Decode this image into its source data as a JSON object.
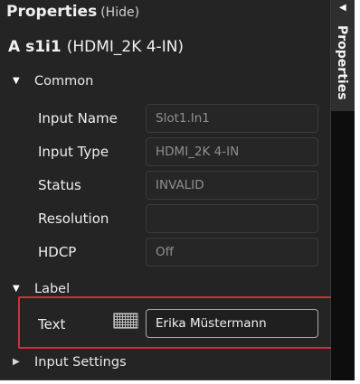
{
  "panel": {
    "title": "Properties",
    "hide_label": "(Hide)"
  },
  "object": {
    "name": "A s1i1",
    "type": "(HDMI_2K 4-IN)"
  },
  "sections": {
    "common": {
      "label": "Common",
      "expanded": true,
      "rows": [
        {
          "label": "Input Name",
          "value": "Slot1.In1"
        },
        {
          "label": "Input Type",
          "value": "HDMI_2K 4-IN"
        },
        {
          "label": "Status",
          "value": "INVALID"
        },
        {
          "label": "Resolution",
          "value": ""
        },
        {
          "label": "HDCP",
          "value": "Off"
        }
      ]
    },
    "label": {
      "label": "Label",
      "expanded": true,
      "text_label": "Text",
      "text_value": "Erika Müstermann"
    },
    "input_settings": {
      "label": "Input Settings",
      "expanded": false
    }
  },
  "side_tab": {
    "label": "Properties"
  },
  "colors": {
    "panel_bg": "#242424",
    "highlight": "#c8323c"
  },
  "icons": {
    "expand": "triangle-down",
    "collapse": "triangle-right",
    "keyboard": "keyboard-icon",
    "tab_arrow": "triangle-left"
  }
}
